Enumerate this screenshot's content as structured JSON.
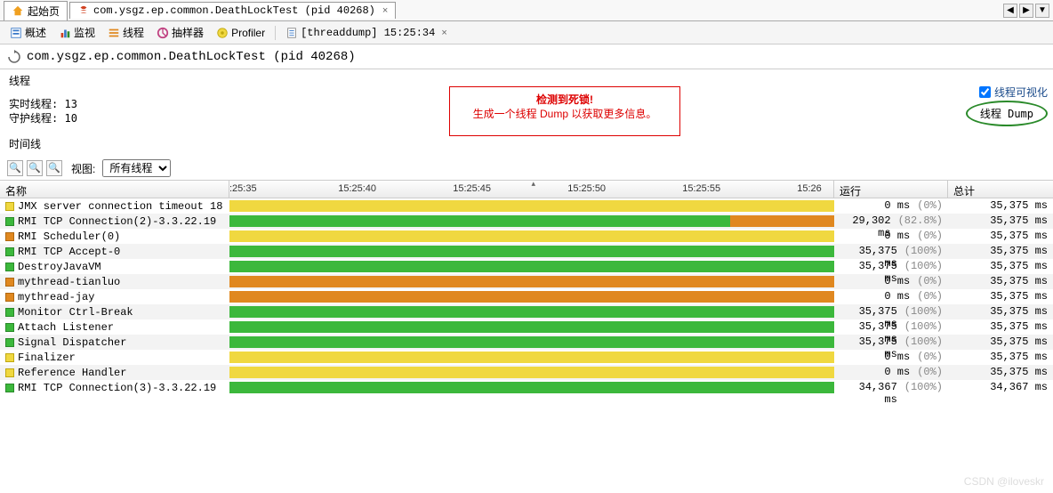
{
  "tabs": {
    "start_page": "起始页",
    "main_tab": "com.ysgz.ep.common.DeathLockTest (pid 40268)"
  },
  "toolbar": {
    "overview": "概述",
    "monitor": "监视",
    "threads": "线程",
    "sampler": "抽样器",
    "profiler": "Profiler",
    "threaddump": "[threaddump] 15:25:34"
  },
  "title": "com.ysgz.ep.common.DeathLockTest (pid 40268)",
  "section": {
    "threads_label": "线程",
    "realtime_label": "实时线程:",
    "realtime_value": "13",
    "daemon_label": "守护线程:",
    "daemon_value": "10",
    "timeline_label": "时间线",
    "view_label": "视图:",
    "view_value": "所有线程",
    "visualize_label": "线程可视化",
    "dump_btn": "线程 Dump"
  },
  "alert": {
    "line1": "检测到死锁!",
    "line2": "生成一个线程 Dump 以获取更多信息。"
  },
  "columns": {
    "name": "名称",
    "run": "运行",
    "total": "总计"
  },
  "ticks": [
    ":25:35",
    "15:25:40",
    "15:25:45",
    "15:25:50",
    "15:25:55",
    "15:26"
  ],
  "threads": [
    {
      "name": "JMX server connection timeout 18",
      "color": "yellow",
      "bars": [
        {
          "c": "yellow",
          "l": 0,
          "w": 100
        }
      ],
      "run": "0 ms",
      "pct": "(0%)",
      "total": "35,375 ms"
    },
    {
      "name": "RMI TCP Connection(2)-3.3.22.19",
      "color": "green",
      "bars": [
        {
          "c": "green",
          "l": 0,
          "w": 82.8
        },
        {
          "c": "orange",
          "l": 82.8,
          "w": 17.2
        }
      ],
      "run": "29,302 ms",
      "pct": "(82.8%)",
      "total": "35,375 ms"
    },
    {
      "name": "RMI Scheduler(0)",
      "color": "orange",
      "bars": [
        {
          "c": "yellow",
          "l": 0,
          "w": 100
        }
      ],
      "run": "0 ms",
      "pct": "(0%)",
      "total": "35,375 ms"
    },
    {
      "name": "RMI TCP Accept-0",
      "color": "green",
      "bars": [
        {
          "c": "green",
          "l": 0,
          "w": 100
        }
      ],
      "run": "35,375 ms",
      "pct": "(100%)",
      "total": "35,375 ms"
    },
    {
      "name": "DestroyJavaVM",
      "color": "green",
      "bars": [
        {
          "c": "green",
          "l": 0,
          "w": 100
        }
      ],
      "run": "35,375 ms",
      "pct": "(100%)",
      "total": "35,375 ms"
    },
    {
      "name": "mythread-tianluo",
      "color": "orange",
      "bars": [
        {
          "c": "orange",
          "l": 0,
          "w": 100
        }
      ],
      "run": "0 ms",
      "pct": "(0%)",
      "total": "35,375 ms"
    },
    {
      "name": "mythread-jay",
      "color": "orange",
      "bars": [
        {
          "c": "orange",
          "l": 0,
          "w": 100
        }
      ],
      "run": "0 ms",
      "pct": "(0%)",
      "total": "35,375 ms"
    },
    {
      "name": "Monitor Ctrl-Break",
      "color": "green",
      "bars": [
        {
          "c": "green",
          "l": 0,
          "w": 100
        }
      ],
      "run": "35,375 ms",
      "pct": "(100%)",
      "total": "35,375 ms"
    },
    {
      "name": "Attach Listener",
      "color": "green",
      "bars": [
        {
          "c": "green",
          "l": 0,
          "w": 100
        }
      ],
      "run": "35,375 ms",
      "pct": "(100%)",
      "total": "35,375 ms"
    },
    {
      "name": "Signal Dispatcher",
      "color": "green",
      "bars": [
        {
          "c": "green",
          "l": 0,
          "w": 100
        }
      ],
      "run": "35,375 ms",
      "pct": "(100%)",
      "total": "35,375 ms"
    },
    {
      "name": "Finalizer",
      "color": "yellow",
      "bars": [
        {
          "c": "yellow",
          "l": 0,
          "w": 100
        }
      ],
      "run": "0 ms",
      "pct": "(0%)",
      "total": "35,375 ms"
    },
    {
      "name": "Reference Handler",
      "color": "yellow",
      "bars": [
        {
          "c": "yellow",
          "l": 0,
          "w": 100
        }
      ],
      "run": "0 ms",
      "pct": "(0%)",
      "total": "35,375 ms"
    },
    {
      "name": "RMI TCP Connection(3)-3.3.22.19",
      "color": "green",
      "bars": [
        {
          "c": "green",
          "l": 0,
          "w": 100
        }
      ],
      "run": "34,367 ms",
      "pct": "(100%)",
      "total": "34,367 ms"
    }
  ],
  "watermark1": "",
  "watermark2": "CSDN @iloveskr"
}
